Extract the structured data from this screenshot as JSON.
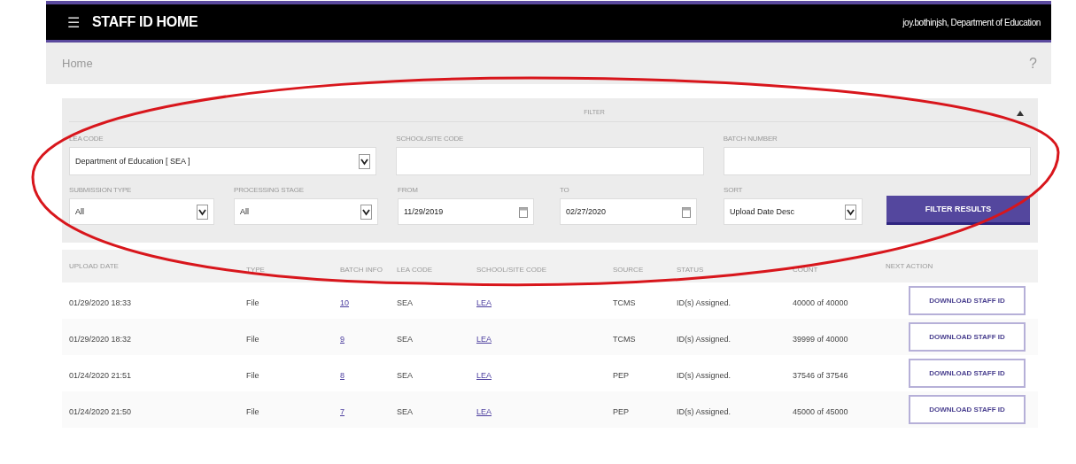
{
  "header": {
    "menu_icon": "☰",
    "title": "STAFF ID HOME",
    "user": "joy.bothinjsh, Department of Education"
  },
  "breadcrumb": {
    "text": "Home",
    "help": "?"
  },
  "filter": {
    "title": "FILTER",
    "expanded": true,
    "row_1": [
      {
        "label": "LEA CODE",
        "kind": "select",
        "value": "Department of Education [ SEA ]"
      },
      {
        "label": "SCHOOL/SITE CODE",
        "kind": "text"
      },
      {
        "label": "BATCH NUMBER",
        "kind": "text"
      }
    ],
    "row_2": [
      {
        "label": "SUBMISSION TYPE",
        "kind": "select",
        "value": "All"
      },
      {
        "label": "PROCESSING STAGE",
        "kind": "select",
        "value": "All"
      },
      {
        "label": "FROM",
        "kind": "date",
        "value": "11/29/2019"
      },
      {
        "label": "TO",
        "kind": "date",
        "value": "02/27/2020"
      },
      {
        "label": "SORT",
        "kind": "select",
        "value": "Upload Date Desc"
      }
    ],
    "button": "FILTER RESULTS"
  },
  "table": {
    "columns": [
      "UPLOAD DATE",
      "TYPE",
      "BATCH INFO",
      "LEA CODE",
      "SCHOOL/SITE CODE",
      "SOURCE",
      "STATUS",
      "COUNT",
      "NEXT ACTION"
    ],
    "rows": [
      {
        "upload_date": "01/29/2020 18:33",
        "submission_type": "File",
        "batch_info": "10",
        "lea_code": "SEA",
        "school_site_code": "LEA",
        "source_system": "TCMS",
        "status": "ID(s) Assigned.",
        "record_count": "40000 of 40000",
        "next_action": "DOWNLOAD STAFF ID"
      },
      {
        "upload_date": "01/29/2020 18:32",
        "submission_type": "File",
        "batch_info": "9",
        "lea_code": "SEA",
        "school_site_code": "LEA",
        "source_system": "TCMS",
        "status": "ID(s) Assigned.",
        "record_count": "39999 of 40000",
        "next_action": "DOWNLOAD STAFF ID"
      },
      {
        "upload_date": "01/24/2020 21:51",
        "submission_type": "File",
        "batch_info": "8",
        "lea_code": "SEA",
        "school_site_code": "LEA",
        "source_system": "PEP",
        "status": "ID(s) Assigned.",
        "record_count": "37546 of 37546",
        "next_action": "DOWNLOAD STAFF ID"
      },
      {
        "upload_date": "01/24/2020 21:50",
        "submission_type": "File",
        "batch_info": "7",
        "lea_code": "SEA",
        "school_site_code": "LEA",
        "source_system": "PEP",
        "status": "ID(s) Assigned.",
        "record_count": "45000 of 45000",
        "next_action": "DOWNLOAD STAFF ID"
      }
    ]
  }
}
